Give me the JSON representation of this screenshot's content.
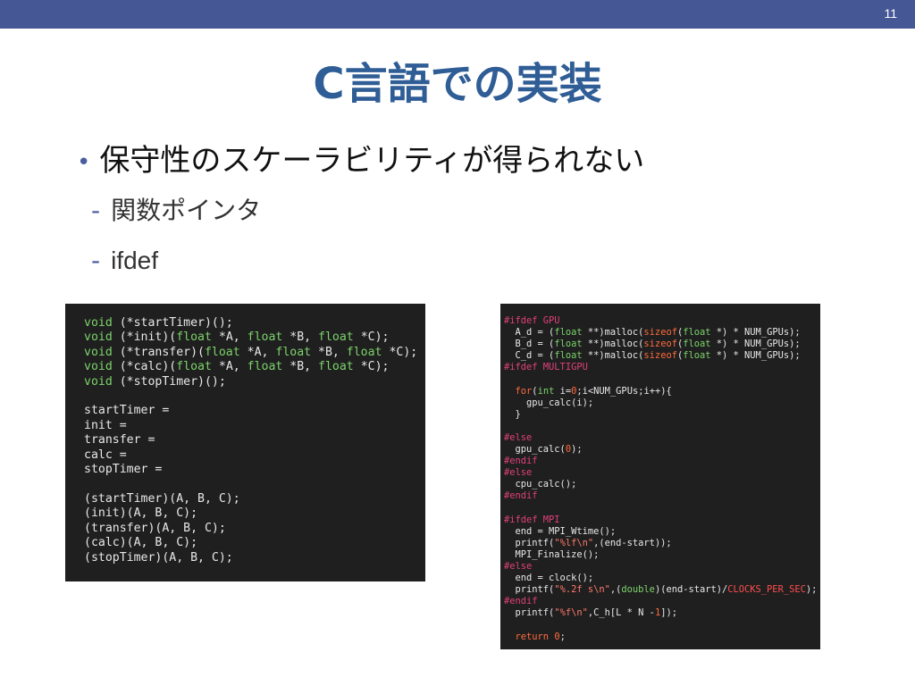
{
  "slide": {
    "page_number": "11",
    "title": "C言語での実装",
    "bullet": "保守性のスケーラビリティが得られない",
    "subbullets": [
      "関数ポインタ",
      "ifdef"
    ],
    "colors": {
      "header_bar": "#465796",
      "title": "#2f5d95",
      "code_bg": "#1f1f1f",
      "keyword": "#7cd36b",
      "preprocessor": "#e0407a"
    }
  },
  "code_left": [
    "void (*startTimer)();",
    "void (*init)(float *A, float *B, float *C);",
    "void (*transfer)(float *A, float *B, float *C);",
    "void (*calc)(float *A, float *B, float *C);",
    "void (*stopTimer)();",
    "",
    "startTimer =",
    "init =",
    "transfer =",
    "calc =",
    "stopTimer =",
    "",
    "(startTimer)(A, B, C);",
    "(init)(A, B, C);",
    "(transfer)(A, B, C);",
    "(calc)(A, B, C);",
    "(stopTimer)(A, B, C);"
  ],
  "code_right": [
    "#ifdef GPU",
    "  A_d = (float **)malloc(sizeof(float *) * NUM_GPUs);",
    "  B_d = (float **)malloc(sizeof(float *) * NUM_GPUs);",
    "  C_d = (float **)malloc(sizeof(float *) * NUM_GPUs);",
    "#ifdef MULTIGPU",
    "",
    "  for(int i=0;i<NUM_GPUs;i++){",
    "    gpu_calc(i);",
    "  }",
    "",
    "#else",
    "  gpu_calc(0);",
    "#endif",
    "#else",
    "  cpu_calc();",
    "#endif",
    "",
    "#ifdef MPI",
    "  end = MPI_Wtime();",
    "  printf(\"%lf\\n\",(end-start));",
    "  MPI_Finalize();",
    "#else",
    "  end = clock();",
    "  printf(\"%.2f s\\n\",(double)(end-start)/CLOCKS_PER_SEC);",
    "#endif",
    "  printf(\"%f\\n\",C_h[L * N -1]);",
    "",
    "  return 0;"
  ]
}
